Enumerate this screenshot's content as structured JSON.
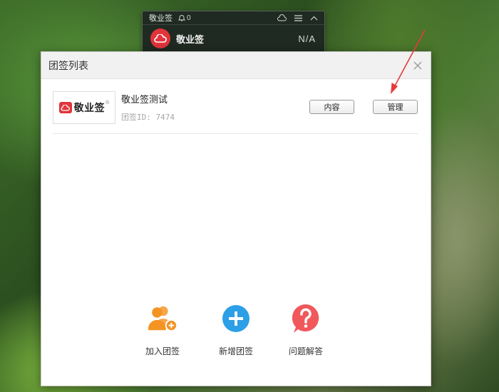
{
  "mini_widget": {
    "title": "敬业签",
    "notification_count": "0",
    "note_name": "敬业签",
    "note_value": "N/A"
  },
  "dialog": {
    "title": "团签列表",
    "group": {
      "logo_text": "敬业签",
      "name": "敬业签测试",
      "id_text": "团签ID: 7474",
      "content_button": "内容",
      "manage_button": "管理"
    },
    "actions": [
      {
        "label": "加入团签",
        "icon": "join-group-icon",
        "color": "#f59323"
      },
      {
        "label": "新增团签",
        "icon": "add-group-icon",
        "color": "#2d9fe6"
      },
      {
        "label": "问题解答",
        "icon": "help-icon",
        "color": "#f0585c"
      }
    ]
  },
  "colors": {
    "brand_red": "#e2343b",
    "annotation_arrow": "#e53b3b"
  }
}
